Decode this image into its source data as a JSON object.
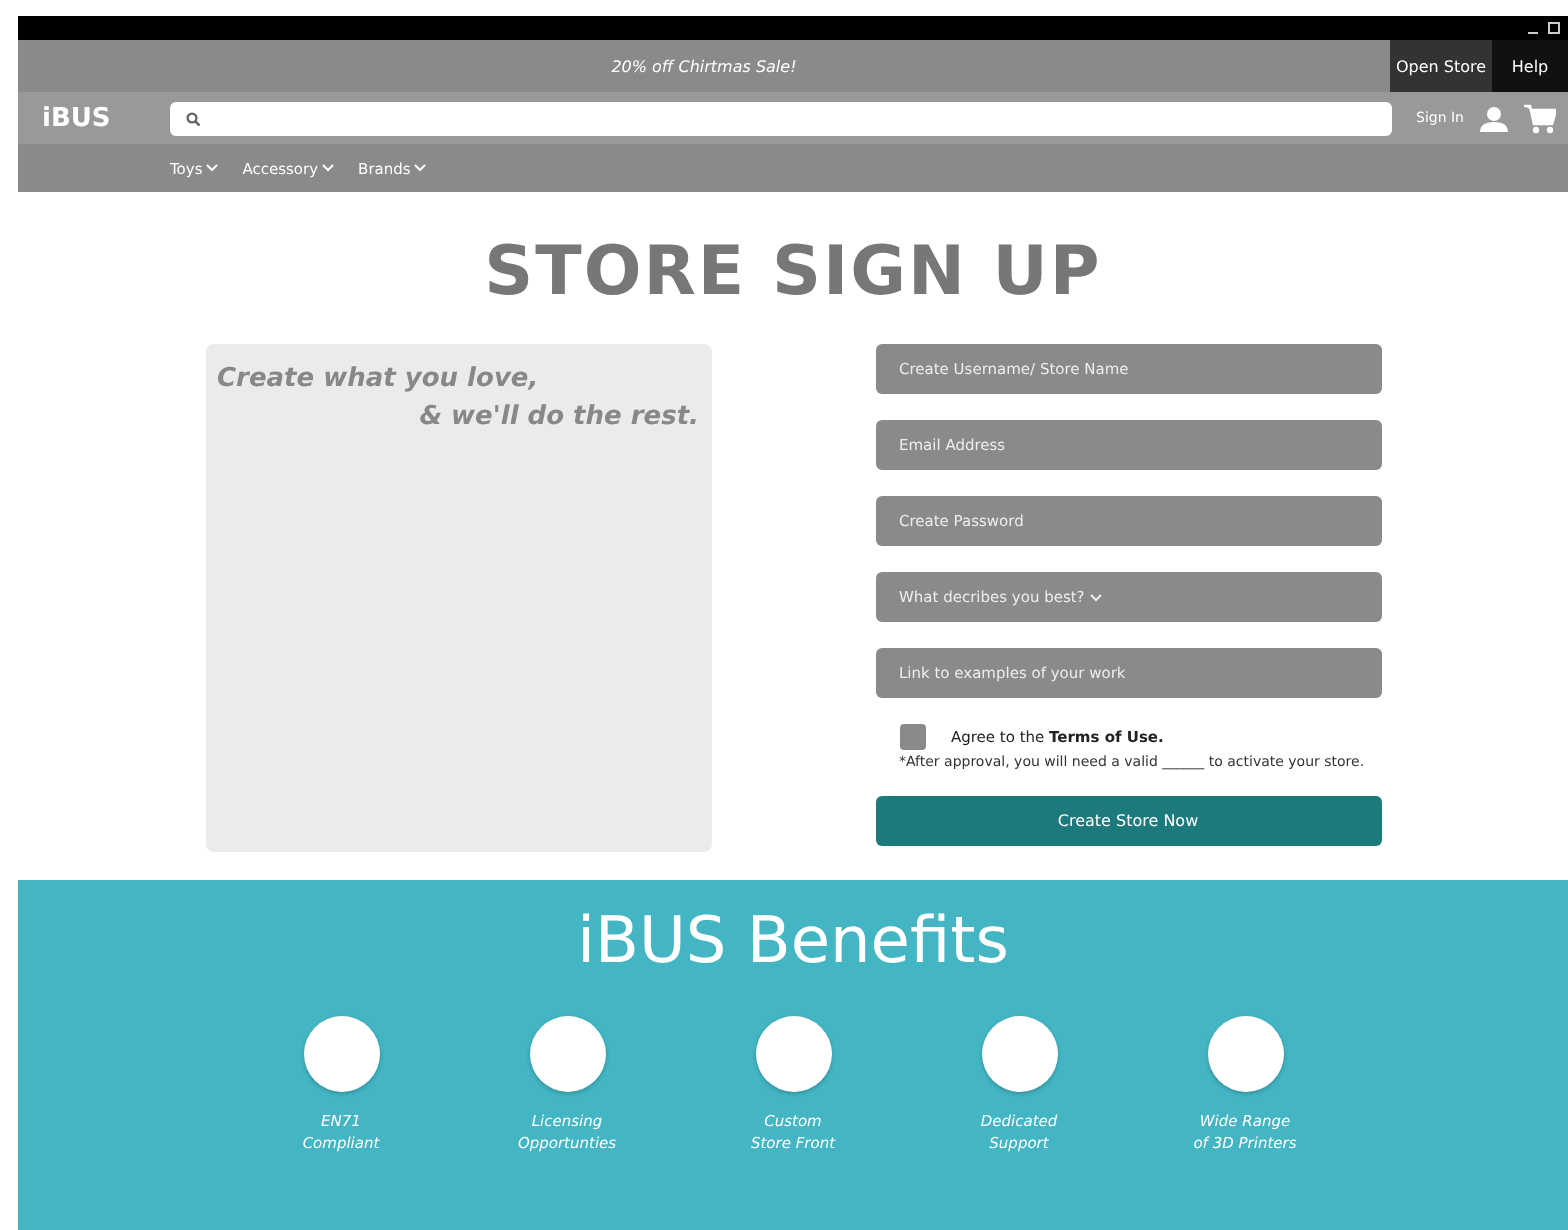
{
  "promo": {
    "text": "20% off Chirtmas Sale!"
  },
  "top_links": [
    {
      "label": "Open Store",
      "kind": "store"
    },
    {
      "label": "Help",
      "kind": "help"
    }
  ],
  "header": {
    "logo": "iBUS",
    "sign_in": "Sign In"
  },
  "nav": [
    {
      "label": "Toys"
    },
    {
      "label": "Accessory"
    },
    {
      "label": "Brands"
    }
  ],
  "title": "STORE SIGN UP",
  "tagline": [
    "Create what you love,",
    "& we'll do the rest."
  ],
  "fields": [
    {
      "placeholder": "Create Username/ Store Name",
      "kind": "text"
    },
    {
      "placeholder": "Email Address",
      "kind": "text"
    },
    {
      "placeholder": "Create Password",
      "kind": "text"
    },
    {
      "placeholder": "What decribes you best?",
      "kind": "select"
    },
    {
      "placeholder": "Link to examples of your work",
      "kind": "text"
    }
  ],
  "agree": {
    "label": "Agree to the **Terms of Use.**",
    "checked": false
  },
  "note": "*After approval, you will need a valid ______ to activate your store.",
  "submit": "Create Store Now",
  "benefits": {
    "title": "iBUS Benefits",
    "items": [
      [
        "EN71",
        "Compliant"
      ],
      [
        "Licensing",
        "Opportunties"
      ],
      [
        "Custom",
        "Store Front"
      ],
      [
        "Dedicated",
        "Support"
      ],
      [
        "Wide Range",
        "of 3D Printers"
      ]
    ]
  }
}
